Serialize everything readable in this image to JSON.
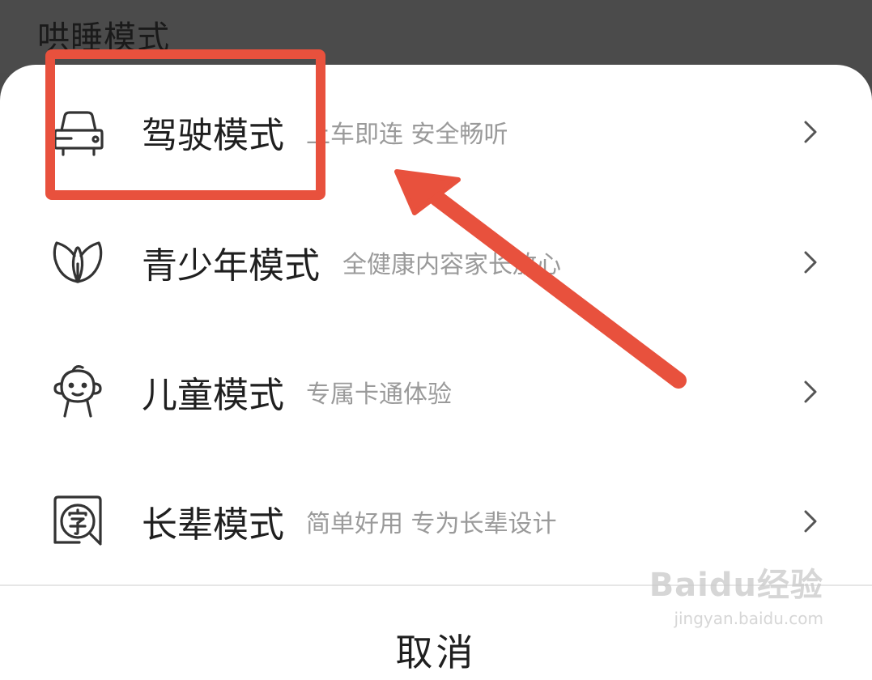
{
  "header": {
    "title": "哄睡模式"
  },
  "modes": [
    {
      "icon": "car-icon",
      "name": "驾驶模式",
      "desc": "上车即连  安全畅听"
    },
    {
      "icon": "leaf-icon",
      "name": "青少年模式",
      "desc": "全健康内容家长放心"
    },
    {
      "icon": "child-face-icon",
      "name": "儿童模式",
      "desc": "专属卡通体验"
    },
    {
      "icon": "elder-font-icon",
      "name": "长辈模式",
      "desc": "简单好用  专为长辈设计"
    }
  ],
  "footer": {
    "cancel_label": "取消"
  },
  "watermark": {
    "brand": "Baidu经验",
    "url": "jingyan.baidu.com"
  },
  "colors": {
    "highlight": "#e8513d",
    "sheet": "#ffffff",
    "backdrop": "#4b4b4b"
  }
}
